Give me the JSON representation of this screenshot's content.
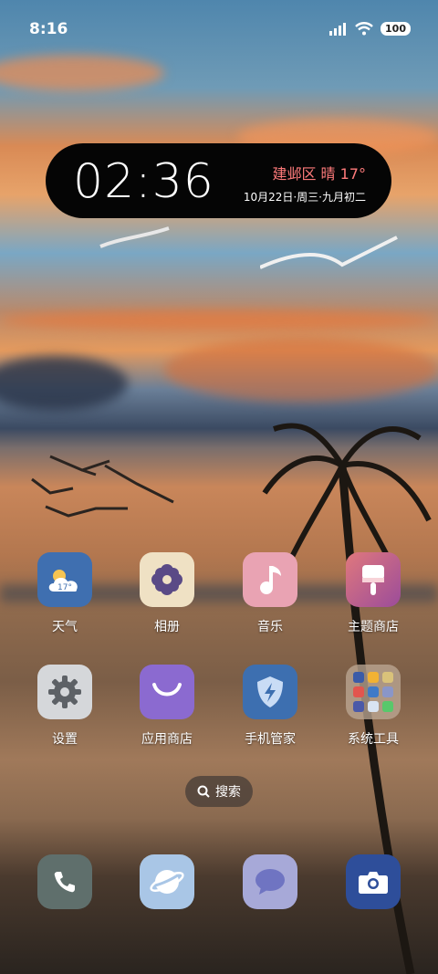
{
  "status_bar": {
    "time": "8:16",
    "battery": "100"
  },
  "clock_widget": {
    "time": "02:36",
    "weather": "建邺区 晴 17°",
    "date": "10月22日·周三·九月初二"
  },
  "apps_row1": [
    {
      "label": "天气",
      "icon": "weather-icon",
      "temp": "17°"
    },
    {
      "label": "相册",
      "icon": "gallery-flower-icon"
    },
    {
      "label": "音乐",
      "icon": "music-note-icon"
    },
    {
      "label": "主题商店",
      "icon": "theme-brush-icon"
    }
  ],
  "apps_row2": [
    {
      "label": "设置",
      "icon": "gear-icon"
    },
    {
      "label": "应用商店",
      "icon": "store-bag-icon"
    },
    {
      "label": "手机管家",
      "icon": "shield-bolt-icon"
    },
    {
      "label": "系统工具",
      "icon": "folder-icon"
    }
  ],
  "search": {
    "label": "搜索"
  },
  "dock": [
    {
      "name": "phone",
      "icon": "phone-icon"
    },
    {
      "name": "browser",
      "icon": "planet-icon"
    },
    {
      "name": "messages",
      "icon": "message-bubble-icon"
    },
    {
      "name": "camera",
      "icon": "camera-icon"
    }
  ],
  "colors": {
    "weather_bg": "#3f6fb0",
    "gallery_bg": "#efe1c4",
    "music_bg": "#e9a3b3",
    "theme_bg": "#c05a7e",
    "settings_bg": "#d5d7da",
    "store_bg": "#8b6ad0",
    "guard_bg": "#3d6fb0",
    "phone_bg": "#5f6f6c",
    "browser_bg": "#a9c6e6",
    "message_bg": "#a7a9d8",
    "camera_bg": "#2e4e9a",
    "widget_weather_text": "#ff7b7b"
  }
}
